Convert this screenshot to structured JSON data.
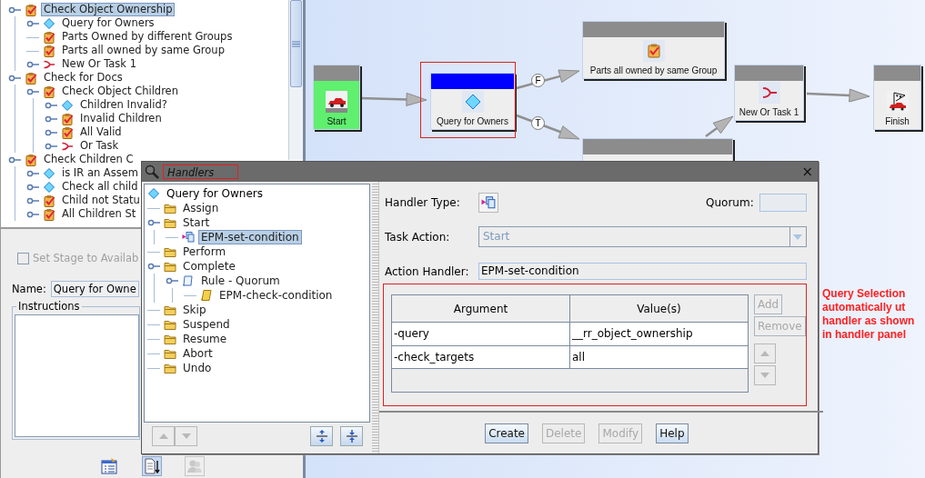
{
  "tree": {
    "items": [
      {
        "label": "Check Object Ownership",
        "kind": "task",
        "selected": true,
        "expandable": true,
        "children": [
          {
            "label": "Query for Owners",
            "kind": "condition",
            "selected": false,
            "expandable": true
          },
          {
            "label": "Parts Owned by different Groups",
            "kind": "task",
            "selected": false,
            "expandable": false
          },
          {
            "label": "Parts all owned by same Group",
            "kind": "task",
            "selected": false,
            "expandable": false
          },
          {
            "label": "New Or Task 1",
            "kind": "or",
            "selected": false,
            "expandable": true
          }
        ]
      },
      {
        "label": "Check for Docs",
        "kind": "task",
        "selected": false,
        "expandable": true,
        "children": [
          {
            "label": "Check Object Children",
            "kind": "task",
            "selected": false,
            "expandable": true,
            "children": [
              {
                "label": "Children Invalid?",
                "kind": "condition",
                "selected": false,
                "expandable": true
              },
              {
                "label": "Invalid Children",
                "kind": "task",
                "selected": false,
                "expandable": true
              },
              {
                "label": "All Valid",
                "kind": "task",
                "selected": false,
                "expandable": true
              },
              {
                "label": "Or Task",
                "kind": "or",
                "selected": false,
                "expandable": true
              }
            ]
          }
        ]
      },
      {
        "label": "Check Children C",
        "kind": "task",
        "selected": false,
        "expandable": true,
        "children": [
          {
            "label": "is IR an Assem",
            "kind": "condition",
            "selected": false,
            "expandable": true
          },
          {
            "label": "Check all child",
            "kind": "condition",
            "selected": false,
            "expandable": true
          },
          {
            "label": "Child not Statu",
            "kind": "task",
            "selected": false,
            "expandable": true
          },
          {
            "label": "All Children St",
            "kind": "task",
            "selected": false,
            "expandable": true
          }
        ]
      }
    ]
  },
  "props": {
    "checkbox": {
      "label": "Set Stage to Availab",
      "checked": false,
      "disabled": true
    },
    "name": {
      "label": "Name:",
      "value": "Query for Owne"
    },
    "instructions": {
      "label": "Instructions"
    }
  },
  "canvas": {
    "nodes": [
      {
        "label": "Start",
        "kind": "start",
        "selected": false
      },
      {
        "label": "Query for Owners",
        "kind": "condition",
        "selected": true
      },
      {
        "label": "Parts all owned by same Group",
        "kind": "task",
        "selected": false
      },
      {
        "label": "New Or Task 1",
        "kind": "or",
        "selected": false
      },
      {
        "label": "Finish",
        "kind": "finish",
        "selected": false
      },
      {
        "kind": "stub",
        "selected": false
      }
    ],
    "branch_labels": [
      "F",
      "T"
    ]
  },
  "dialog": {
    "title": "Handlers",
    "close": "×",
    "tree": {
      "root": {
        "label": "Query for Owners",
        "kind": "condition",
        "selected": false
      },
      "items": [
        {
          "label": "Assign",
          "kind": "folder",
          "selected": false,
          "expandable": false
        },
        {
          "label": "Start",
          "kind": "folder",
          "selected": false,
          "expandable": true,
          "children": [
            {
              "label": "EPM-set-condition",
              "kind": "handler",
              "selected": true,
              "expandable": false
            }
          ]
        },
        {
          "label": "Perform",
          "kind": "folder",
          "selected": false,
          "expandable": false
        },
        {
          "label": "Complete",
          "kind": "folder",
          "selected": false,
          "expandable": true,
          "children": [
            {
              "label": "Rule - Quorum",
              "kind": "rule",
              "selected": false,
              "expandable": true,
              "children": [
                {
                  "label": "EPM-check-condition",
                  "kind": "scroll",
                  "selected": false,
                  "expandable": false
                }
              ]
            }
          ]
        },
        {
          "label": "Skip",
          "kind": "folder",
          "selected": false,
          "expandable": false
        },
        {
          "label": "Suspend",
          "kind": "folder",
          "selected": false,
          "expandable": false
        },
        {
          "label": "Resume",
          "kind": "folder",
          "selected": false,
          "expandable": false
        },
        {
          "label": "Abort",
          "kind": "folder",
          "selected": false,
          "expandable": false
        },
        {
          "label": "Undo",
          "kind": "folder",
          "selected": false,
          "expandable": false
        }
      ]
    },
    "handler_type": {
      "label": "Handler Type:"
    },
    "quorum": {
      "label": "Quorum:",
      "disabled": true
    },
    "task_action": {
      "label": "Task Action:",
      "value": "Start",
      "disabled": true
    },
    "action_handler": {
      "label": "Action Handler:",
      "value": "EPM-set-condition"
    },
    "table": {
      "columns": [
        "Argument",
        "Value(s)"
      ],
      "rows": [
        [
          "-query",
          "__rr_object_ownership"
        ],
        [
          "-check_targets",
          "all"
        ]
      ]
    },
    "side_buttons": [
      {
        "label": "Add",
        "disabled": true
      },
      {
        "label": "Remove",
        "disabled": true
      }
    ],
    "buttons": [
      {
        "label": "Create",
        "disabled": false
      },
      {
        "label": "Delete",
        "disabled": true
      },
      {
        "label": "Modify",
        "disabled": true
      },
      {
        "label": "Help",
        "disabled": false
      }
    ]
  },
  "annotation": "Query Selection\nautomatically ut\nhandler as shown\nin handler panel"
}
